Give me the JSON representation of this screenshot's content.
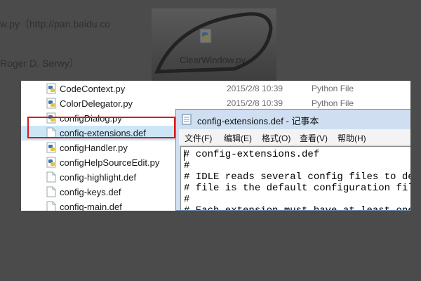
{
  "background": {
    "text_line1": "w.py（http://pan.baidu.co",
    "text_line2": "Roger D. Serwy）",
    "desktop_icon_caption": "ClearWindow.py"
  },
  "explorer": {
    "rows": [
      {
        "name": "CodeContext.py",
        "date": "2015/2/8 10:39",
        "type": "Python File",
        "icon": "python-file-icon"
      },
      {
        "name": "ColorDelegator.py",
        "date": "2015/2/8 10:39",
        "type": "Python File",
        "icon": "python-file-icon"
      },
      {
        "name": "configDialog.py",
        "date": "",
        "type": "",
        "icon": "python-file-icon"
      },
      {
        "name": "config-extensions.def",
        "date": "",
        "type": "",
        "icon": "text-file-icon",
        "selected": true
      },
      {
        "name": "configHandler.py",
        "date": "",
        "type": "",
        "icon": "python-file-icon"
      },
      {
        "name": "configHelpSourceEdit.py",
        "date": "",
        "type": "",
        "icon": "python-file-icon"
      },
      {
        "name": "config-highlight.def",
        "date": "",
        "type": "",
        "icon": "text-file-icon"
      },
      {
        "name": "config-keys.def",
        "date": "",
        "type": "",
        "icon": "text-file-icon"
      },
      {
        "name": "config-main.def",
        "date": "",
        "type": "",
        "icon": "text-file-icon"
      }
    ],
    "highlight_color": "#d7191c",
    "selection_color": "#cde6f7"
  },
  "notepad": {
    "title": "config-extensions.def - 记事本",
    "menu": [
      "文件(F)",
      "编辑(E)",
      "格式(O)",
      "查看(V)",
      "帮助(H)"
    ],
    "lines": [
      "# config-extensions.def",
      "#",
      "# IDLE reads several config files to det",
      "# file is the default configuration file",
      "#",
      "# Each extension must have at least one"
    ]
  }
}
